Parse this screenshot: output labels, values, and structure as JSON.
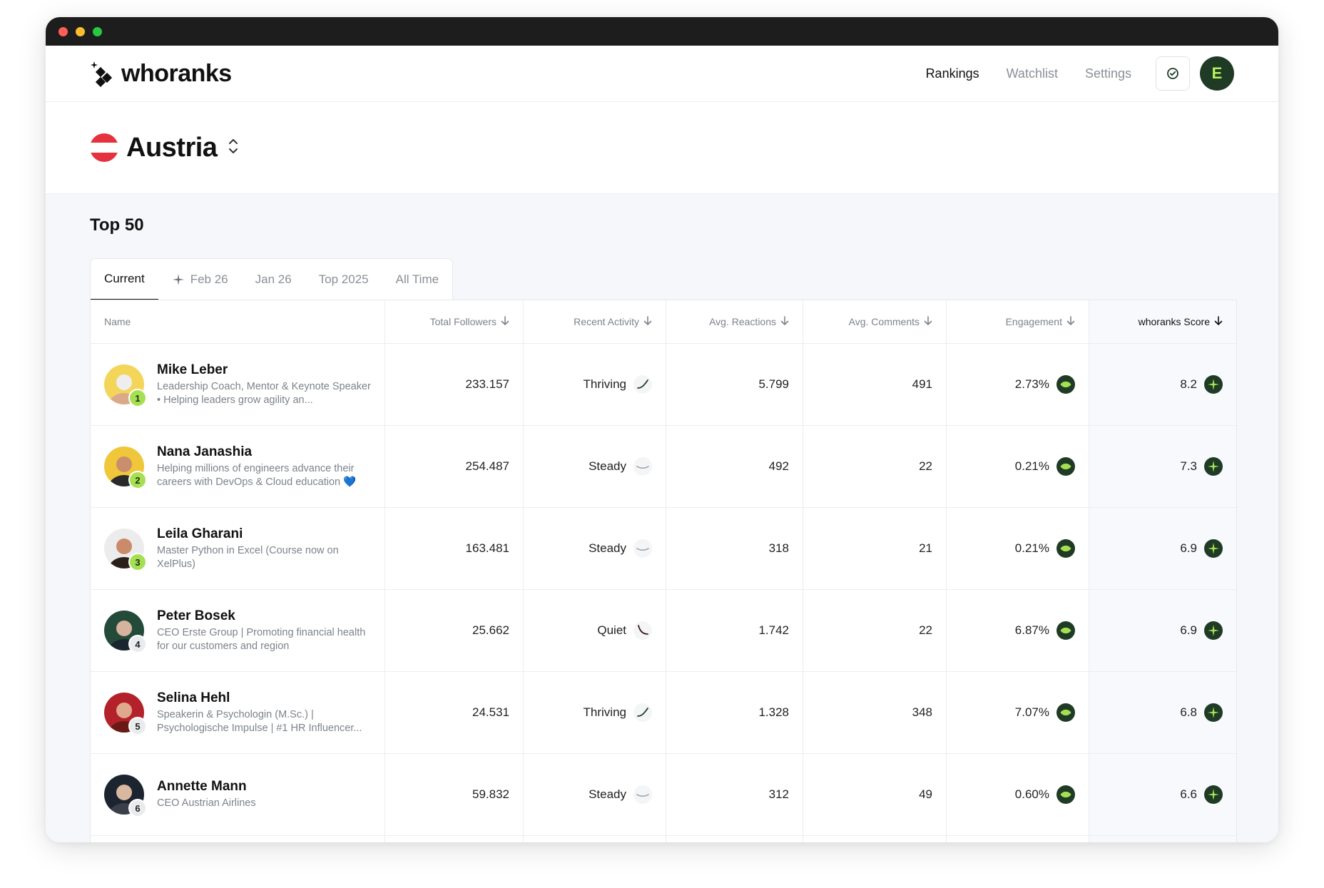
{
  "app": {
    "name": "whoranks"
  },
  "nav": {
    "links": [
      "Rankings",
      "Watchlist",
      "Settings"
    ],
    "active": "Rankings",
    "avatar_initial": "E"
  },
  "country": {
    "name": "Austria"
  },
  "section": {
    "title": "Top 50"
  },
  "tabs": [
    {
      "label": "Current",
      "active": true,
      "icon": ""
    },
    {
      "label": "Feb 26",
      "active": false,
      "icon": "sparkle-icon"
    },
    {
      "label": "Jan 26",
      "active": false,
      "icon": ""
    },
    {
      "label": "Top 2025",
      "active": false,
      "icon": ""
    },
    {
      "label": "All Time",
      "active": false,
      "icon": ""
    }
  ],
  "table": {
    "columns": [
      "Name",
      "Total Followers",
      "Recent Activity",
      "Avg. Reactions",
      "Avg. Comments",
      "Engagement",
      "whoranks Score"
    ],
    "rows": [
      {
        "rank": "1",
        "name": "Mike Leber",
        "bio": "Leadership Coach, Mentor & Keynote Speaker • Helping leaders grow agility an...",
        "followers": "233.157",
        "activity": "Thriving",
        "reactions": "5.799",
        "comments": "491",
        "engagement": "2.73%",
        "score": "8.2"
      },
      {
        "rank": "2",
        "name": "Nana Janashia",
        "bio": "Helping millions of engineers advance their careers with DevOps & Cloud education 💙",
        "followers": "254.487",
        "activity": "Steady",
        "reactions": "492",
        "comments": "22",
        "engagement": "0.21%",
        "score": "7.3"
      },
      {
        "rank": "3",
        "name": "Leila Gharani",
        "bio": "Master Python in Excel (Course now on XelPlus)",
        "followers": "163.481",
        "activity": "Steady",
        "reactions": "318",
        "comments": "21",
        "engagement": "0.21%",
        "score": "6.9"
      },
      {
        "rank": "4",
        "name": "Peter Bosek",
        "bio": "CEO Erste Group | Promoting financial health for our customers and region",
        "followers": "25.662",
        "activity": "Quiet",
        "reactions": "1.742",
        "comments": "22",
        "engagement": "6.87%",
        "score": "6.9"
      },
      {
        "rank": "5",
        "name": "Selina Hehl",
        "bio": "Speakerin & Psychologin (M.Sc.) | Psychologische Impulse | #1 HR Influencer...",
        "followers": "24.531",
        "activity": "Thriving",
        "reactions": "1.328",
        "comments": "348",
        "engagement": "7.07%",
        "score": "6.8"
      },
      {
        "rank": "6",
        "name": "Annette Mann",
        "bio": "CEO Austrian Airlines",
        "followers": "59.832",
        "activity": "Steady",
        "reactions": "312",
        "comments": "49",
        "engagement": "0.60%",
        "score": "6.6"
      }
    ]
  },
  "colors": {
    "accent_dark": "#1f3b25",
    "accent_lime": "#a6e052",
    "flag_red": "#e5323f",
    "background": "#f5f7fb"
  }
}
